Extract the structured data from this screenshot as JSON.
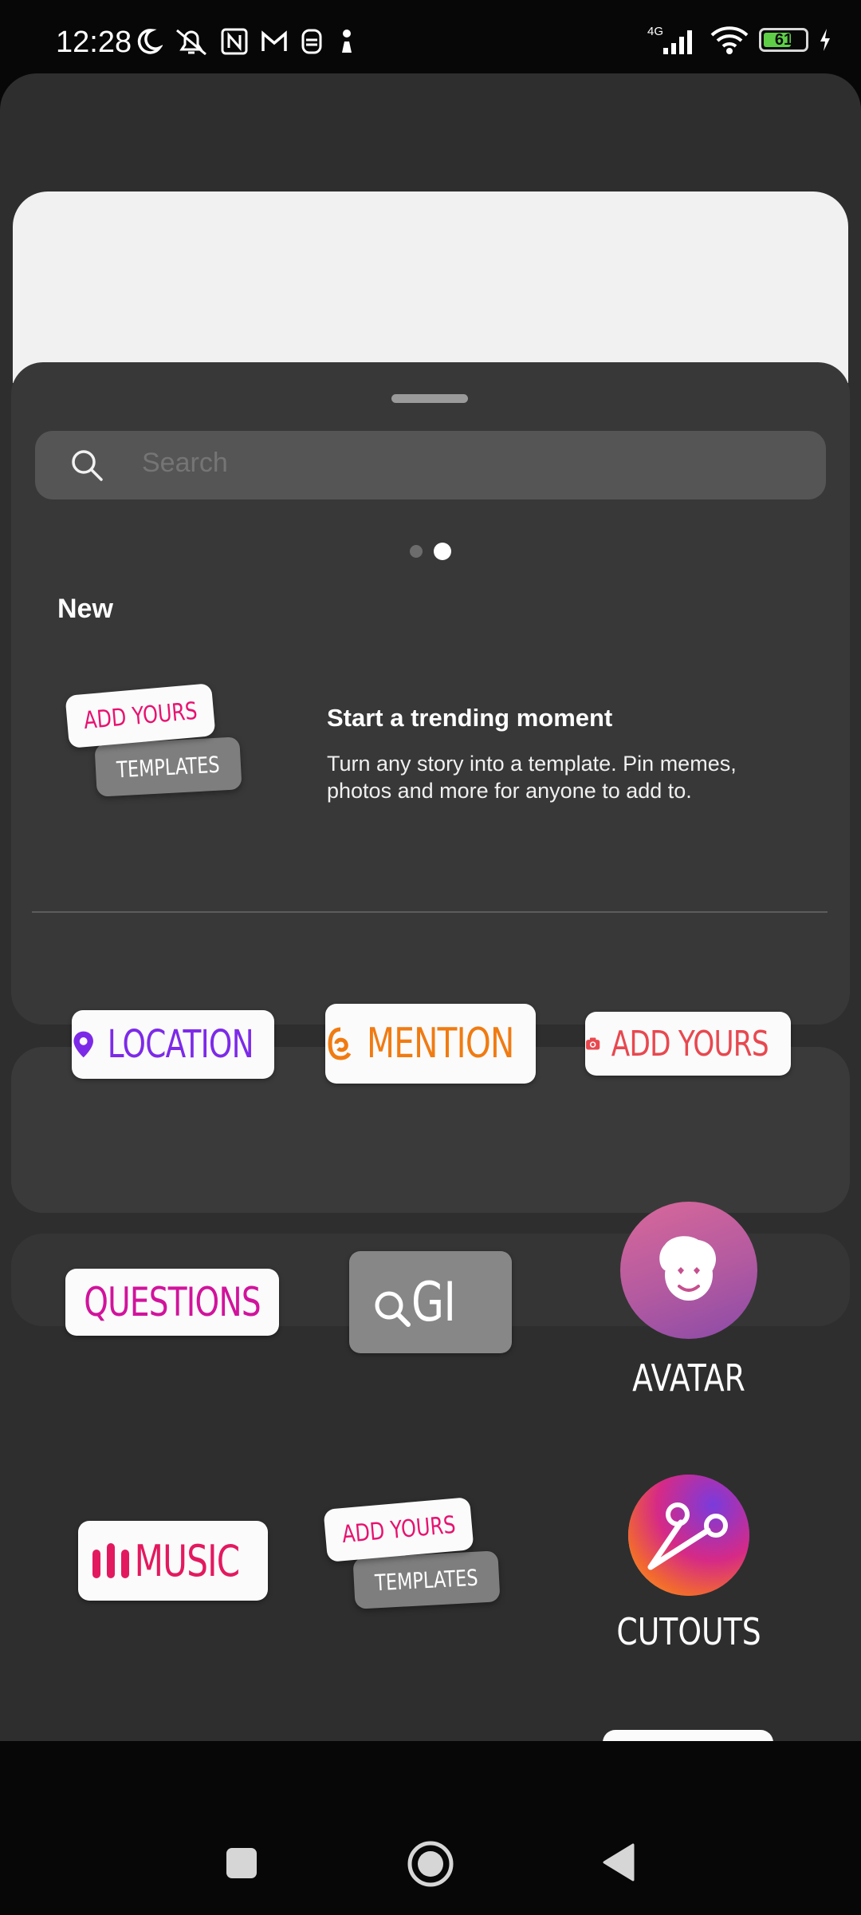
{
  "status_bar": {
    "time": "12:28",
    "network": "4G",
    "battery": "61",
    "icons": [
      "moon-icon",
      "alarm-off-icon",
      "nfc-icon",
      "gmail-icon",
      "app-icon",
      "chess-icon",
      "signal-icon",
      "wifi-icon",
      "battery-icon",
      "charging-icon"
    ]
  },
  "search": {
    "placeholder": "Search"
  },
  "pager": {
    "pages": 2,
    "active": 2
  },
  "section": {
    "title": "New"
  },
  "new_item": {
    "sticker_top": "ADD YOURS",
    "sticker_bottom": "TEMPLATES",
    "title": "Start a trending moment",
    "description": "Turn any story into a template. Pin memes, photos and more for anyone to add to."
  },
  "stickers": {
    "location": "LOCATION",
    "mention": "MENTION",
    "add_yours": "ADD YOURS",
    "questions": "QUESTIONS",
    "gif": "GI",
    "avatar": "AVATAR",
    "music": "MUSIC",
    "templates_top": "ADD YOURS",
    "templates_bottom": "TEMPLATES",
    "cutouts": "CUTOUTS"
  },
  "colors": {
    "location": "#7d2ae8",
    "mention": "#f07b12",
    "add_yours": "#e8484f",
    "questions": "#d1139c",
    "music": "#e3195f",
    "sheet": "#383838"
  },
  "nav": {
    "buttons": [
      "recents-button",
      "home-button",
      "back-button"
    ]
  }
}
